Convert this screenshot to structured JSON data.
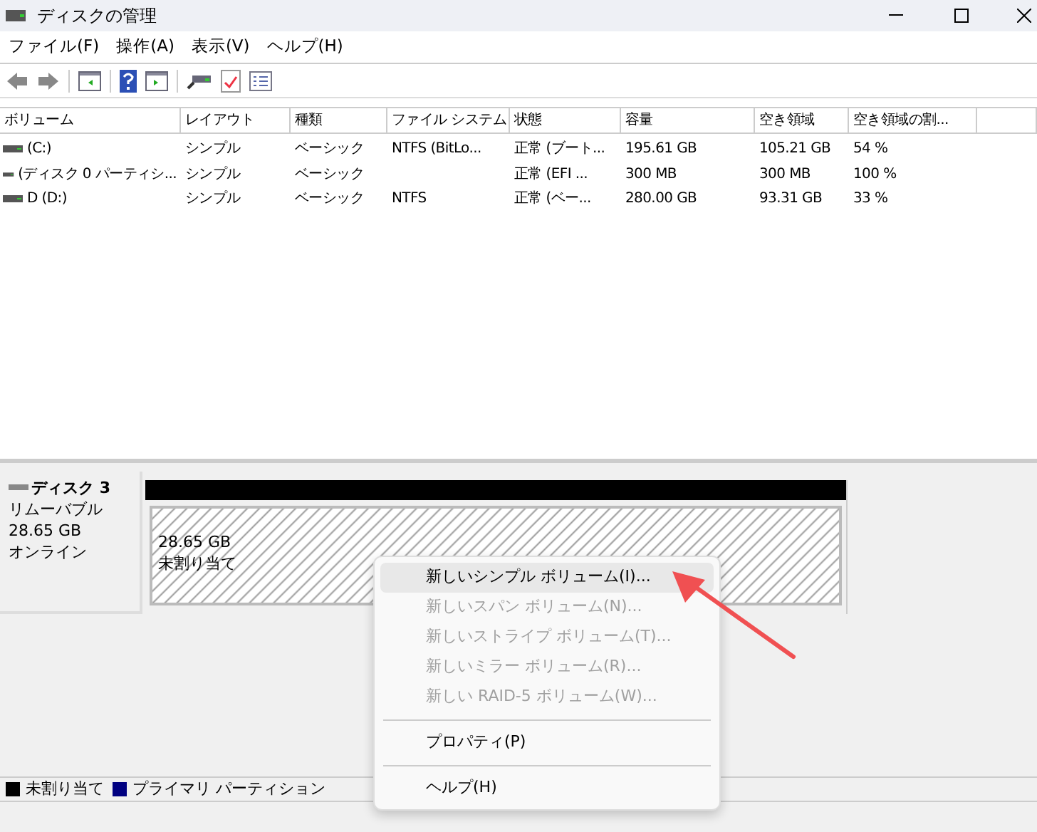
{
  "window": {
    "title": "ディスクの管理"
  },
  "menu_bar": [
    "ファイル(F)",
    "操作(A)",
    "表示(V)",
    "ヘルプ(H)"
  ],
  "table": {
    "columns": [
      "ボリューム",
      "レイアウト",
      "種類",
      "ファイル システム",
      "状態",
      "容量",
      "空き領域",
      "空き領域の割..."
    ],
    "rows": [
      [
        "(C:)",
        "シンプル",
        "ベーシック",
        "NTFS (BitLo...",
        "正常 (ブート...",
        "195.61 GB",
        "105.21 GB",
        "54 %"
      ],
      [
        "(ディスク 0 パーティシ...",
        "シンプル",
        "ベーシック",
        "",
        "正常 (EFI ...",
        "300 MB",
        "300 MB",
        "100 %"
      ],
      [
        "D (D:)",
        "シンプル",
        "ベーシック",
        "NTFS",
        "正常 (ベー...",
        "280.00 GB",
        "93.31 GB",
        "33 %"
      ]
    ]
  },
  "disk": {
    "name": "ディスク 3",
    "type": "リムーバブル",
    "size": "28.65 GB",
    "status": "オンライン",
    "partition": {
      "size": "28.65 GB",
      "label": "未割り当て"
    }
  },
  "context_menu": {
    "groups": [
      [
        {
          "label": "新しいシンプル ボリューム(I)...",
          "disabled": false,
          "selected": true
        },
        {
          "label": "新しいスパン ボリューム(N)...",
          "disabled": true,
          "selected": false
        },
        {
          "label": "新しいストライプ ボリューム(T)...",
          "disabled": true,
          "selected": false
        },
        {
          "label": "新しいミラー ボリューム(R)...",
          "disabled": true,
          "selected": false
        },
        {
          "label": "新しい RAID-5 ボリューム(W)...",
          "disabled": true,
          "selected": false
        }
      ],
      [
        {
          "label": "プロパティ(P)",
          "disabled": false,
          "selected": false
        }
      ],
      [
        {
          "label": "ヘルプ(H)",
          "disabled": false,
          "selected": false
        }
      ]
    ]
  },
  "legend": [
    {
      "label": "未割り当て",
      "color": "#000000"
    },
    {
      "label": "プライマリ パーティション",
      "color": "#000080"
    }
  ]
}
